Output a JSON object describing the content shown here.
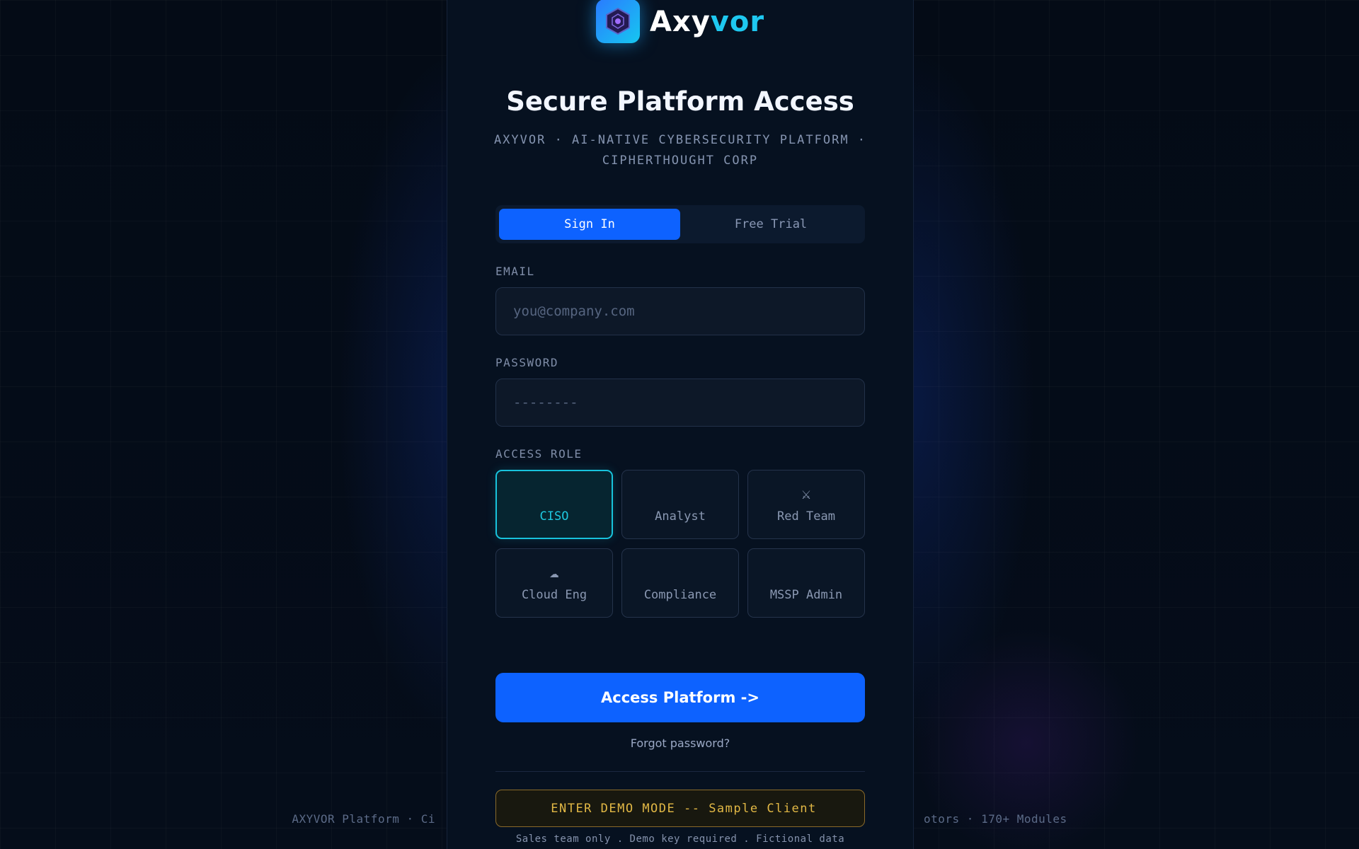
{
  "brand": {
    "name_part1": "Axy",
    "name_part2": "vor",
    "logo_icon": "hexagon-shield-icon",
    "accent_color": "#1ec8f0",
    "primary_color": "#0d62ff"
  },
  "header": {
    "title": "Secure Platform Access",
    "subtitle": "AXYVOR · AI-NATIVE CYBERSECURITY PLATFORM · CIPHERTHOUGHT CORP"
  },
  "tabs": [
    {
      "label": "Sign In",
      "active": true
    },
    {
      "label": "Free Trial",
      "active": false
    }
  ],
  "form": {
    "email_label": "EMAIL",
    "email_placeholder": "you@company.com",
    "email_value": "",
    "password_label": "PASSWORD",
    "password_placeholder": "--------",
    "password_value": "",
    "role_label": "ACCESS ROLE",
    "roles": [
      {
        "label": "CISO",
        "icon": "shield-icon",
        "glyph": "",
        "selected": true
      },
      {
        "label": "Analyst",
        "icon": "magnifier-icon",
        "glyph": "",
        "selected": false
      },
      {
        "label": "Red Team",
        "icon": "crossed-swords-icon",
        "glyph": "⚔",
        "selected": false
      },
      {
        "label": "Cloud Eng",
        "icon": "cloud-icon",
        "glyph": "☁",
        "selected": false
      },
      {
        "label": "Compliance",
        "icon": "clipboard-icon",
        "glyph": "",
        "selected": false
      },
      {
        "label": "MSSP Admin",
        "icon": "building-icon",
        "glyph": "",
        "selected": false
      }
    ]
  },
  "actions": {
    "access_label": "Access Platform ->",
    "forgot_label": "Forgot password?",
    "demo_icon": "key-icon",
    "demo_label": "ENTER DEMO MODE -- Sample Client",
    "demo_note": "Sales team only . Demo key required . Fictional data"
  },
  "footer": {
    "text_left": "AXYVOR Platform · Ci",
    "text_right": "otors · 170+ Modules"
  }
}
